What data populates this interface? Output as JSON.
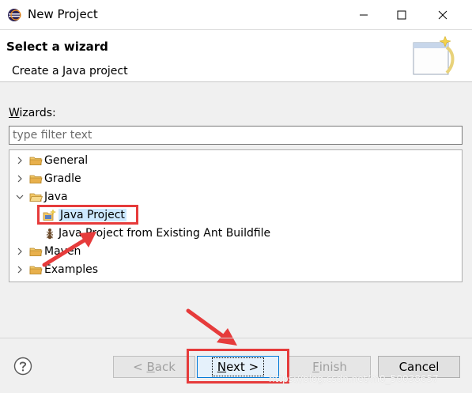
{
  "window": {
    "title": "New Project",
    "icon": "eclipse-icon"
  },
  "header": {
    "title": "Select a wizard",
    "description": "Create a Java project",
    "banner_icon": "new-wizard-banner-icon"
  },
  "wizards": {
    "label_mnemonic": "W",
    "label_rest": "izards:",
    "filter_placeholder": "type filter text",
    "filter_value": ""
  },
  "tree": {
    "items": [
      {
        "label": "General",
        "expanded": false,
        "icon": "folder-icon"
      },
      {
        "label": "Gradle",
        "expanded": false,
        "icon": "folder-icon"
      },
      {
        "label": "Java",
        "expanded": true,
        "icon": "folder-icon"
      },
      {
        "label": "Java Project",
        "icon": "java-project-icon",
        "selected": true
      },
      {
        "label": "Java Project from Existing Ant Buildfile",
        "icon": "ant-icon"
      },
      {
        "label": "Maven",
        "expanded": false,
        "icon": "folder-icon"
      },
      {
        "label": "Examples",
        "expanded": false,
        "icon": "folder-icon"
      }
    ]
  },
  "buttons": {
    "back_symbol": "< ",
    "back_mnemonic": "B",
    "back_rest": "ack",
    "next_mnemonic": "N",
    "next_rest": "ext >",
    "finish_mnemonic": "F",
    "finish_rest": "inish",
    "cancel": "Cancel"
  },
  "watermark": "https://blog.csdn.net/m0_50038657",
  "colors": {
    "highlight": "#e63b3b",
    "selection": "#cce8ff",
    "folder": "#e8b04c"
  }
}
